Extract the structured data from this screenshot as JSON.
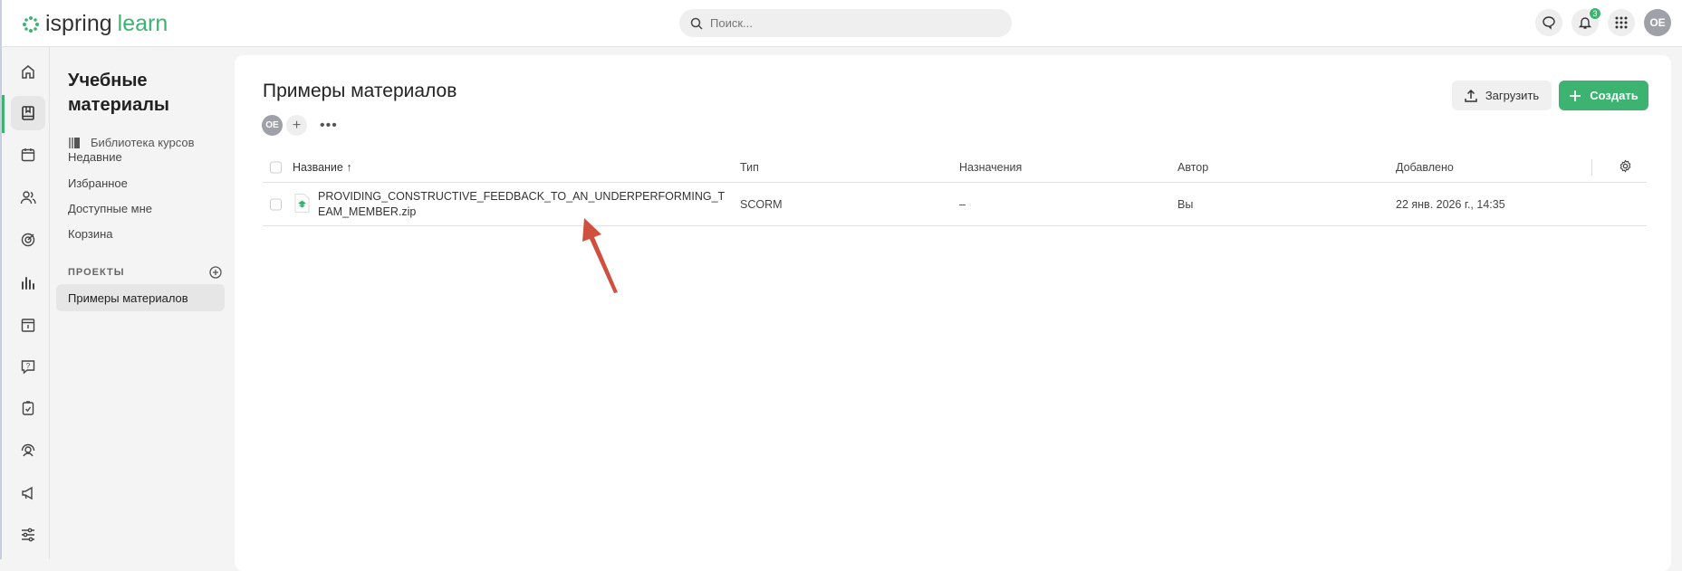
{
  "header": {
    "logo_brand": "ispring",
    "logo_product": "learn",
    "search_placeholder": "Поиск...",
    "notification_count": "3",
    "user_initials": "OE"
  },
  "rail": [
    "home",
    "materials",
    "calendar",
    "users",
    "goals",
    "reports",
    "events",
    "questions",
    "tasks",
    "support",
    "announcements",
    "settings"
  ],
  "sidebar": {
    "title": "Учебные материалы",
    "library": "Библиотека курсов",
    "items": [
      "Недавние",
      "Избранное",
      "Доступные мне",
      "Корзина"
    ],
    "projects_label": "ПРОЕКТЫ",
    "projects": [
      "Примеры материалов"
    ]
  },
  "main": {
    "title": "Примеры материалов",
    "member_initials": "OE",
    "upload_label": "Загрузить",
    "create_label": "Создать",
    "columns": {
      "name": "Название",
      "type": "Тип",
      "assignments": "Назначения",
      "author": "Автор",
      "added": "Добавлено"
    },
    "rows": [
      {
        "name": "PROVIDING_CONSTRUCTIVE_FEEDBACK_TO_AN_UNDERPERFORMING_TEAM_MEMBER.zip",
        "type": "SCORM",
        "assignments": "–",
        "author": "Вы",
        "added": "22 янв. 2026 г., 14:35"
      }
    ]
  },
  "colors": {
    "accent": "#3cb371",
    "annotation": "#d0503f"
  }
}
